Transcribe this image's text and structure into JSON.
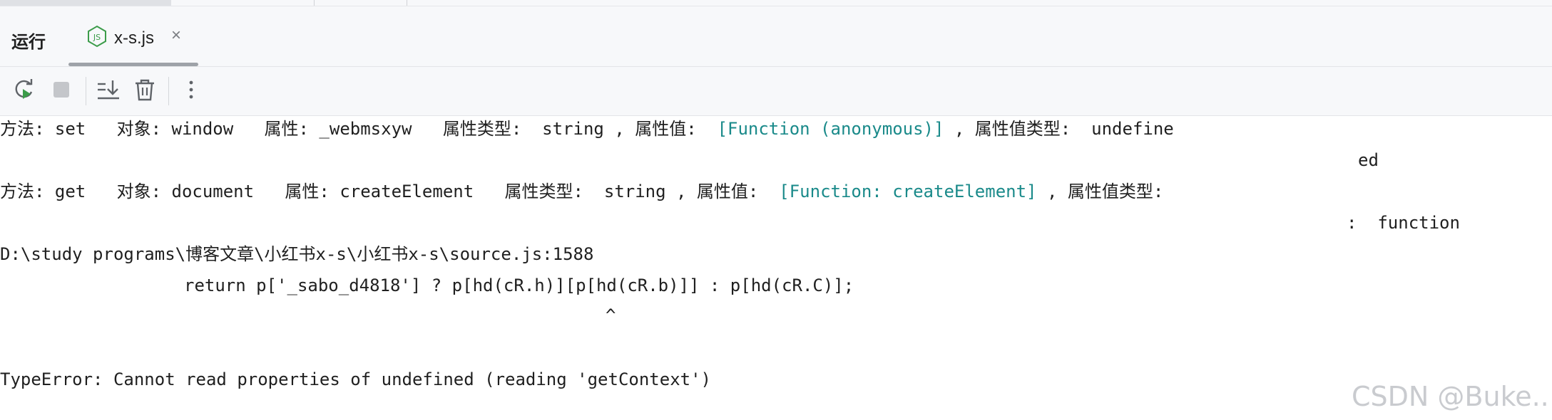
{
  "run_panel": {
    "title": "运行",
    "tab": {
      "label": "x-s.js",
      "close_glyph": "×",
      "icon": "nodejs-icon"
    }
  },
  "toolbar": {
    "buttons": [
      {
        "name": "rerun-button",
        "icon": "rerun-icon"
      },
      {
        "name": "stop-button",
        "icon": "stop-icon"
      },
      {
        "name": "scroll-to-end-button",
        "icon": "scroll-to-end-icon"
      },
      {
        "name": "clear-all-button",
        "icon": "trash-icon"
      },
      {
        "name": "more-options-button",
        "icon": "more-vertical-icon"
      }
    ]
  },
  "console": {
    "line1": {
      "prefix": "方法: set   对象: window   属性: _webmsxyw   属性类型:  string , 属性值:  ",
      "value": "[Function (anonymous)]",
      "suffix": " , 属性值类型:  undefine",
      "wrap": "ed"
    },
    "line2": {
      "prefix": "方法: get   对象: document   属性: createElement   属性类型:  string , 属性值:  ",
      "value": "[Function: createElement]",
      "suffix": " , 属性值类型:",
      "wrap": ":  function"
    },
    "path_line": "D:\\study programs\\博客文章\\小红书x-s\\小红书x-s\\source.js:1588",
    "code_line": "return p['_sabo_d4818'] ? p[hd(cR.h)][p[hd(cR.b)]] : p[hd(cR.C)];",
    "caret": "^",
    "error_line": "TypeError: Cannot read properties of undefined (reading 'getContext')"
  },
  "watermark": "CSDN @Buke..",
  "colors": {
    "function_value": "#1a8a8a",
    "panel_bg": "#f7f8fa",
    "run_icon_green": "#3c9c4a"
  }
}
